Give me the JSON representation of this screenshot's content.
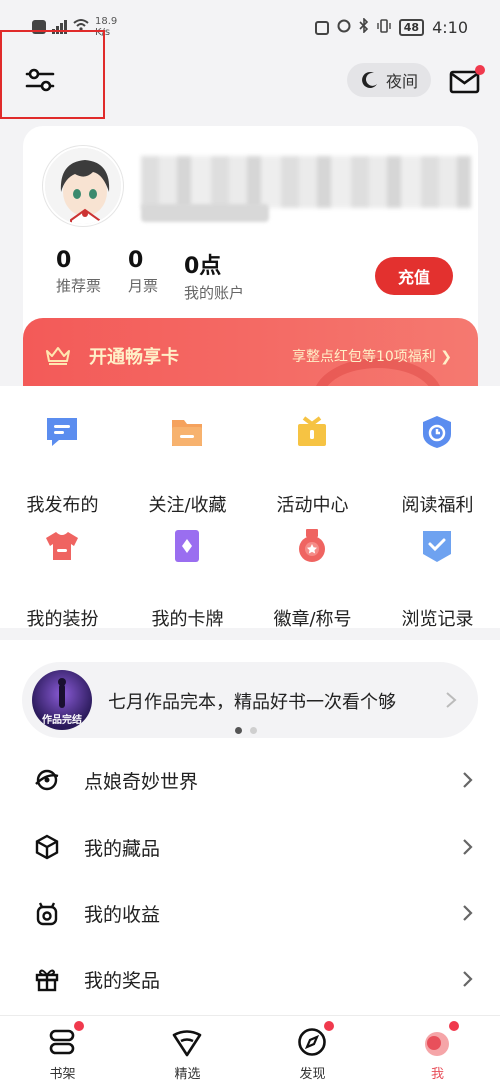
{
  "status_bar": {
    "speed_value": "18.9",
    "speed_unit": "K/s",
    "battery": "48",
    "time": "4:10"
  },
  "header": {
    "night_label": "夜间"
  },
  "profile": {
    "stats": [
      {
        "value": "0",
        "label": "推荐票"
      },
      {
        "value": "0",
        "label": "月票"
      },
      {
        "value": "0点",
        "label": "我的账户"
      }
    ],
    "recharge_label": "充值",
    "vip_title": "开通畅享卡",
    "vip_benefit": "享整点红包等10项福利"
  },
  "grid": [
    {
      "label": "我发布的",
      "icon": "comment-icon",
      "color": "#5b8def"
    },
    {
      "label": "关注/收藏",
      "icon": "folder-icon",
      "color": "#f5a25d"
    },
    {
      "label": "活动中心",
      "icon": "gift-icon",
      "color": "#f6c343"
    },
    {
      "label": "阅读福利",
      "icon": "clock-badge-icon",
      "color": "#5b8def"
    },
    {
      "label": "我的装扮",
      "icon": "tshirt-icon",
      "color": "#ef6461"
    },
    {
      "label": "我的卡牌",
      "icon": "card-icon",
      "color": "#9a6ef0"
    },
    {
      "label": "徽章/称号",
      "icon": "medal-icon",
      "color": "#ef6461"
    },
    {
      "label": "浏览记录",
      "icon": "history-icon",
      "color": "#6ea2f0"
    }
  ],
  "banner": {
    "image_text": "作品完结",
    "text": "七月作品完本，精品好书一次看个够"
  },
  "menu": [
    {
      "label": "点娘奇妙世界",
      "icon": "planet-icon"
    },
    {
      "label": "我的藏品",
      "icon": "cube-icon"
    },
    {
      "label": "我的收益",
      "icon": "wallet-icon"
    },
    {
      "label": "我的奖品",
      "icon": "gift-box-icon"
    }
  ],
  "nav": [
    {
      "label": "书架",
      "icon": "bookshelf-icon"
    },
    {
      "label": "精选",
      "icon": "diamond-icon"
    },
    {
      "label": "发现",
      "icon": "compass-icon"
    },
    {
      "label": "我",
      "icon": "profile-icon"
    }
  ]
}
